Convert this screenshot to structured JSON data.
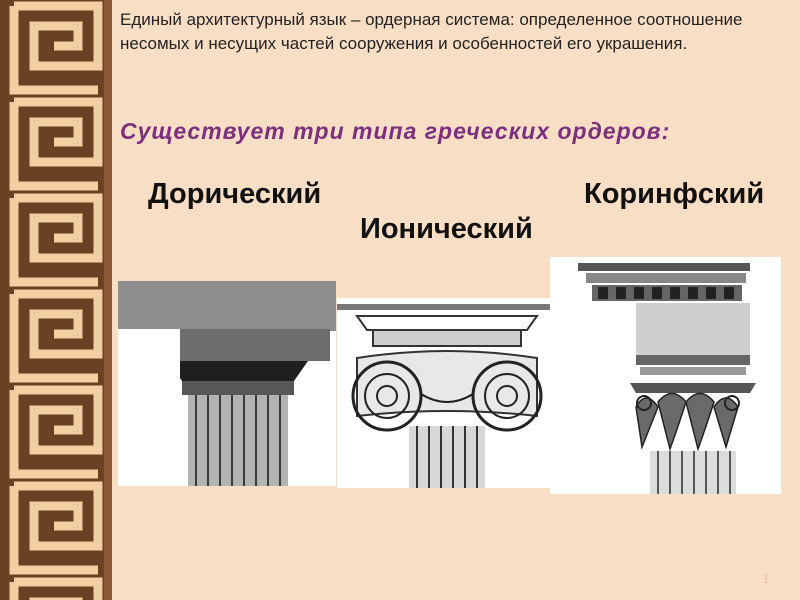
{
  "slide": {
    "intro_text": "Единый архитектурный язык – ордерная система: определенное соотношение несомых и несущих частей сооружения и особенностей его украшения.",
    "subtitle": "Существует  три  типа  греческих  ордеров:",
    "orders": {
      "doric": "Дорический",
      "ionic": "Ионический",
      "corinthian": "Коринфский"
    },
    "slide_number": "1"
  },
  "colors": {
    "border_dark": "#6b4124",
    "border_light": "#f2cfa3",
    "background": "#f9dec6",
    "subtitle": "#7b2f7d"
  },
  "icons": {
    "border": "greek-meander-border",
    "doric": "doric-capital-drawing",
    "ionic": "ionic-capital-drawing",
    "corinthian": "corinthian-capital-drawing"
  }
}
